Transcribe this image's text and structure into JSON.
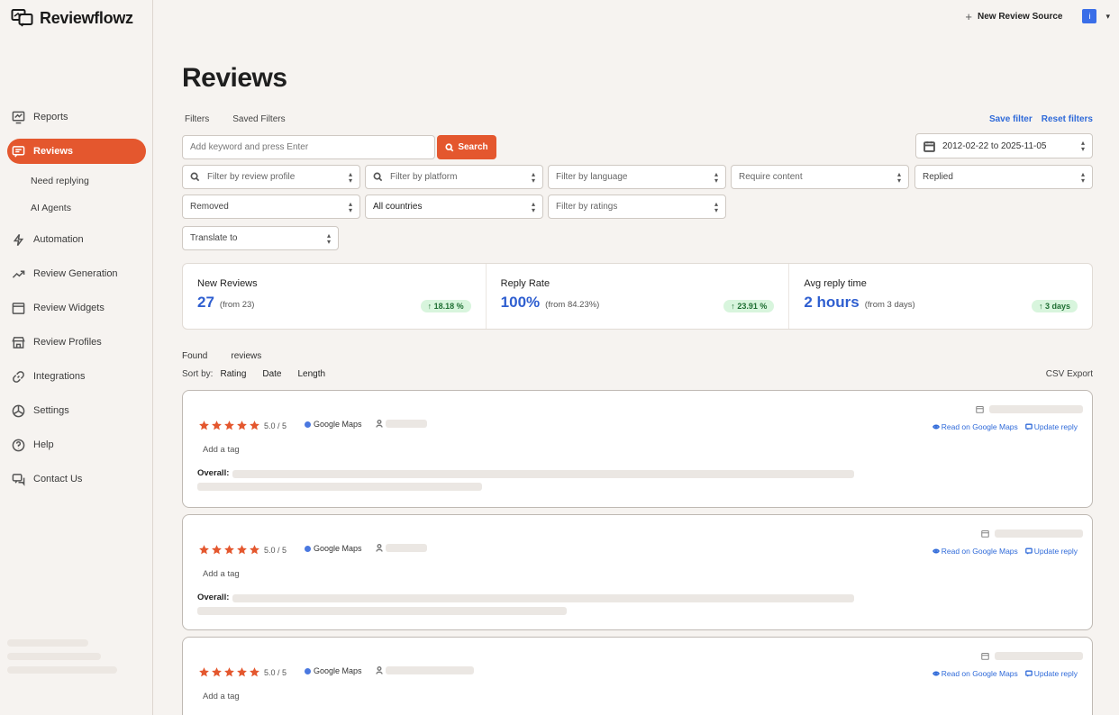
{
  "app": {
    "name": "Reviewflowz"
  },
  "header": {
    "new_source_label": "New Review Source",
    "avatar_letter": "i"
  },
  "sidebar": {
    "items": [
      {
        "label": "Reports",
        "icon": "reports-icon"
      },
      {
        "label": "Reviews",
        "icon": "reviews-icon",
        "active": true
      },
      {
        "label": "Automation",
        "icon": "bolt-icon"
      },
      {
        "label": "Review Generation",
        "icon": "trend-icon"
      },
      {
        "label": "Review Widgets",
        "icon": "widget-icon"
      },
      {
        "label": "Review Profiles",
        "icon": "store-icon"
      },
      {
        "label": "Integrations",
        "icon": "link-icon"
      },
      {
        "label": "Settings",
        "icon": "settings-icon"
      },
      {
        "label": "Help",
        "icon": "help-icon"
      },
      {
        "label": "Contact Us",
        "icon": "chat-icon"
      }
    ],
    "sub_items": [
      "Need replying",
      "AI Agents"
    ]
  },
  "page": {
    "title": "Reviews",
    "filter_tabs": [
      "Filters",
      "Saved Filters"
    ],
    "save_filter": "Save filter",
    "reset_filters": "Reset filters",
    "search_placeholder": "Add keyword and press Enter",
    "search_button": "Search",
    "date_range": "2012-02-22 to 2025-11-05",
    "filters": {
      "review_profile": "Filter by review profile",
      "platform": "Filter by platform",
      "language": "Filter by language",
      "content": "Require content",
      "replied": "Replied",
      "removed": "Removed",
      "countries": "All countries",
      "ratings": "Filter by ratings",
      "translate": "Translate to"
    }
  },
  "stats": [
    {
      "label": "New Reviews",
      "value": "27",
      "from": "(from 23)",
      "badge": "18.18 %"
    },
    {
      "label": "Reply Rate",
      "value": "100%",
      "from": "(from 84.23%)",
      "badge": "23.91 %"
    },
    {
      "label": "Avg reply time",
      "value": "2 hours",
      "from": "(from 3 days)",
      "badge": "3 days"
    }
  ],
  "results": {
    "found_prefix": "Found",
    "found_suffix": "reviews",
    "sort_label": "Sort by:",
    "sort_options": [
      "Rating",
      "Date",
      "Length"
    ],
    "csv_export": "CSV Export"
  },
  "reviews": [
    {
      "rating": 5,
      "rating_text": "5.0 / 5",
      "platform": "Google Maps",
      "read_link": "Read on Google Maps",
      "reply_link": "Update reply",
      "tag_label": "Add a tag",
      "overall_label": "Overall:"
    },
    {
      "rating": 5,
      "rating_text": "5.0 / 5",
      "platform": "Google Maps",
      "read_link": "Read on Google Maps",
      "reply_link": "Update reply",
      "tag_label": "Add a tag",
      "overall_label": "Overall:"
    },
    {
      "rating": 5,
      "rating_text": "5.0 / 5",
      "platform": "Google Maps",
      "read_link": "Read on Google Maps",
      "reply_link": "Update reply",
      "tag_label": "Add a tag"
    }
  ],
  "colors": {
    "accent": "#e4572e",
    "link": "#2f6ad9",
    "stat_value": "#2f5fd0",
    "badge_bg": "#d8f5dd"
  }
}
